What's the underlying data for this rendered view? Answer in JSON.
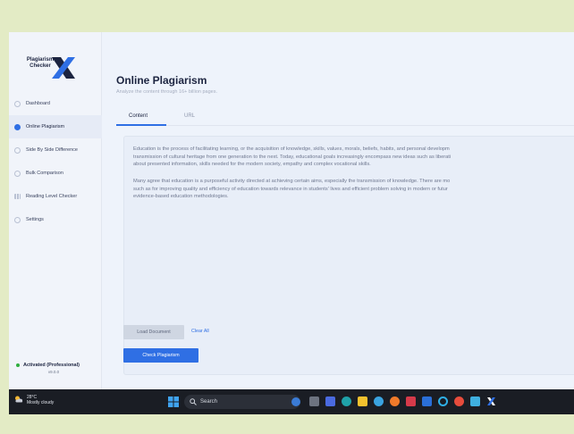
{
  "app": {
    "logo_line1": "Plagiarism",
    "logo_line2": "Checker",
    "logo_mark": "X"
  },
  "sidebar": {
    "items": [
      {
        "label": "Dashboard",
        "icon": "clock-icon"
      },
      {
        "label": "Online Plagiarism",
        "icon": "dot-icon",
        "active": true
      },
      {
        "label": "Side By Side Difference",
        "icon": "compare-icon"
      },
      {
        "label": "Bulk Comparison",
        "icon": "layers-icon"
      },
      {
        "label": "Reading Level Checker",
        "icon": "bars-icon"
      },
      {
        "label": "Settings",
        "icon": "gear-icon"
      }
    ],
    "activation_status": "Activated (Professional)",
    "version": "v9.0.0"
  },
  "main": {
    "title": "Online Plagiarism",
    "subtitle": "Analyze the content through 16+ billion pages.",
    "tabs": [
      {
        "label": "Content",
        "active": true
      },
      {
        "label": "URL",
        "active": false
      }
    ],
    "paragraph1": "Education is the process of facilitating learning, or the acquisition of knowledge, skills, values, morals, beliefs, habits, and personal developm\ntransmission of cultural heritage from one generation to the next. Today, educational goals increasingly encompass new ideas such as liberati\nabout presented information, skills needed for the modern society, empathy and complex vocational skills.",
    "paragraph2": "Many agree that education is a purposeful activity directed at achieving certain aims, especially the transmission of knowledge. There are mo\nsuch as for improving quality and efficiency of education towards relevance in students' lives and efficient problem solving in modern or futur\nevidence-based education methodologies.",
    "load_button": "Load Document",
    "clear_button": "Clear All",
    "check_button": "Check Plagiarism"
  },
  "taskbar": {
    "temperature": "28°C",
    "weather": "Mostly cloudy",
    "search_placeholder": "Search"
  },
  "colors": {
    "accent": "#2f6fe4",
    "active_dot": "#2fae3f",
    "taskbar": "#1a1d24",
    "frame": "#e3ebc5"
  }
}
